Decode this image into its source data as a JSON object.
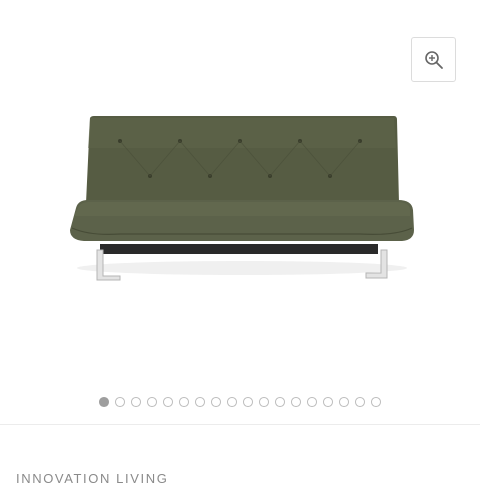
{
  "gallery": {
    "zoom_icon": "zoom-in-icon",
    "image_subject": "olive green tufted sofa bed on chrome sled legs",
    "slide_count": 18,
    "active_slide": 1
  },
  "brand": {
    "name": "INNOVATION LIVING"
  },
  "colors": {
    "upholstery": "#545a42",
    "dot_active": "#9e9e9e",
    "dot_inactive": "#bdbdbd"
  }
}
